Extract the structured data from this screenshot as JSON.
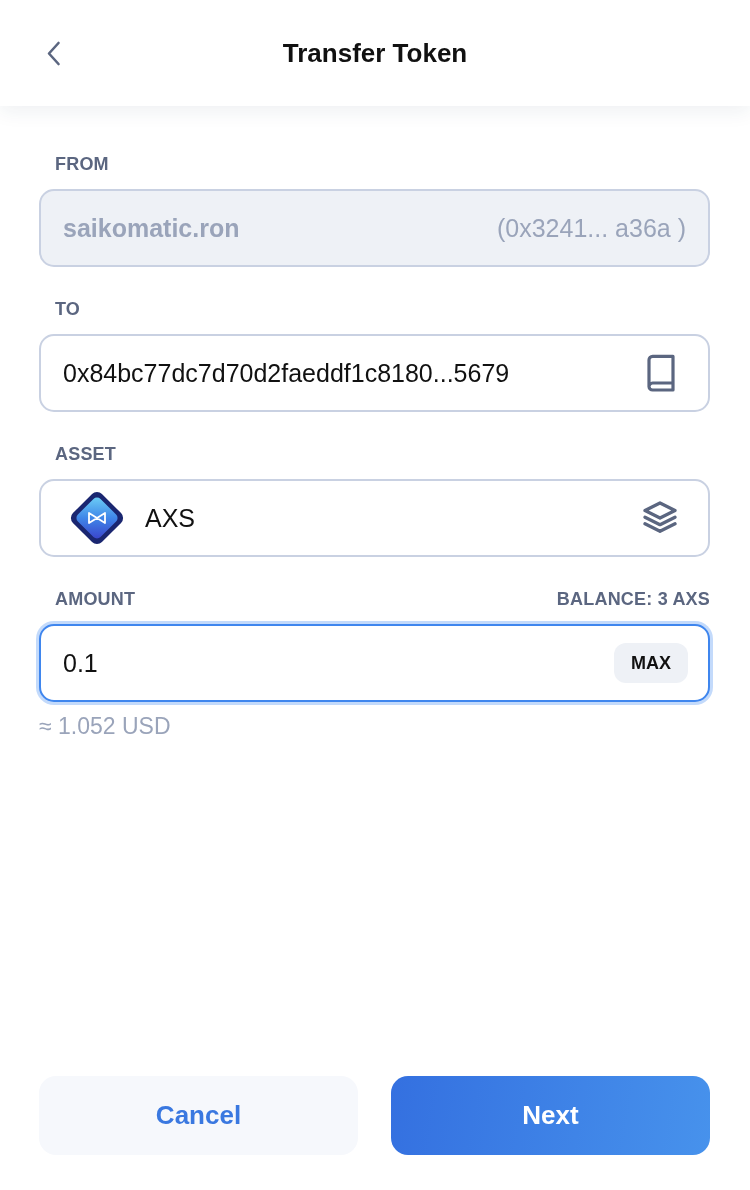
{
  "header": {
    "title": "Transfer Token"
  },
  "from": {
    "label": "FROM",
    "name": "saikomatic.ron",
    "address": "(0x3241... a36a )",
    "disabled": true
  },
  "to": {
    "label": "TO",
    "value": "0x84bc77dc7d70d2faeddf1c8180...5679"
  },
  "asset": {
    "label": "ASSET",
    "value": "AXS"
  },
  "amount": {
    "label": "AMOUNT",
    "balance": "BALANCE: 3 AXS",
    "value": "0.1",
    "focused": true,
    "max_button": "MAX",
    "conversion": "≈ 1.052 USD"
  },
  "buttons": [
    {
      "kind": "secondary",
      "label": "Cancel"
    },
    {
      "kind": "primary",
      "label": "Next"
    }
  ]
}
